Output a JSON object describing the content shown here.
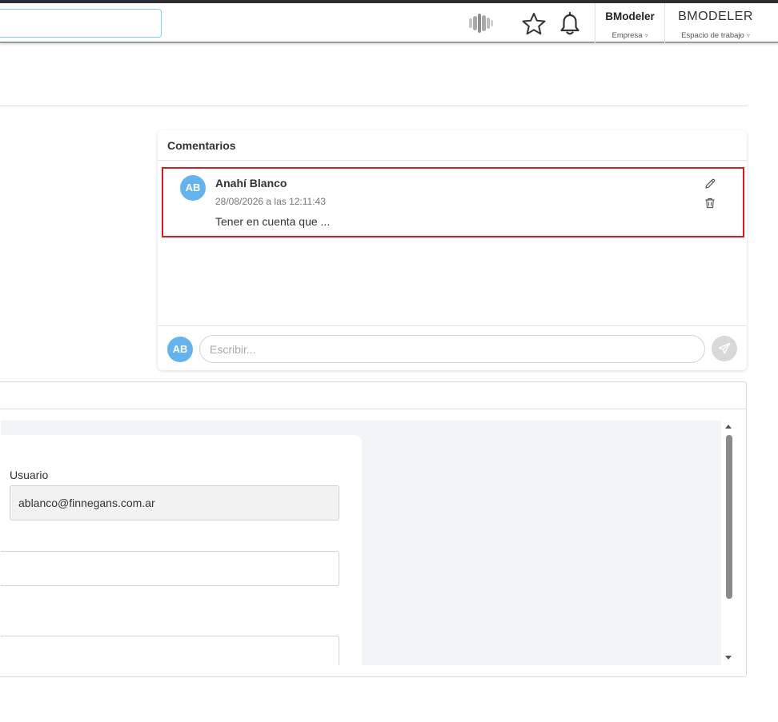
{
  "header": {
    "company_name": "BModeler",
    "company_label": "Empresa",
    "workspace_name": "BMODELER",
    "workspace_label": "Espacio de trabajo",
    "caret": "▿"
  },
  "comments": {
    "title": "Comentarios",
    "items": [
      {
        "initials": "AB",
        "author": "Anahí Blanco",
        "date": "28/08/2026 a las 12:11:43",
        "text": "Tener en cuenta que ..."
      }
    ],
    "composer": {
      "initials": "AB",
      "placeholder": "Escribir..."
    }
  },
  "form": {
    "user_label": "Usuario",
    "user_value": "ablanco@finnegans.com.ar"
  },
  "colors": {
    "avatar": "#63b3ee",
    "highlight_border": "#d51b22",
    "search_border": "#7fd3e6"
  }
}
